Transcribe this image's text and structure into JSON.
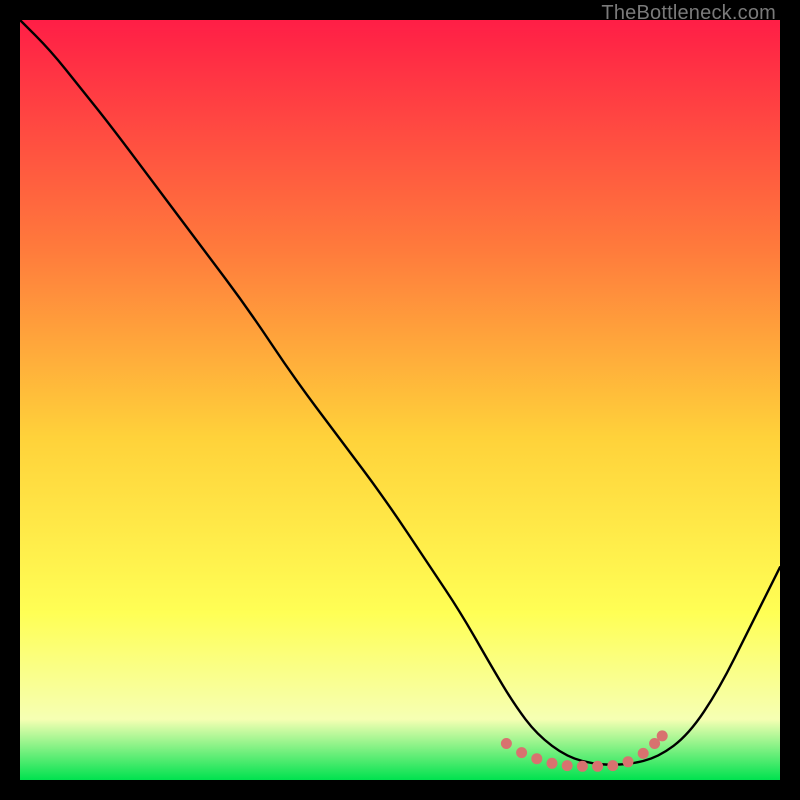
{
  "watermark": "TheBottleneck.com",
  "colors": {
    "gradient_top": "#ff1e46",
    "gradient_mid_upper": "#ff7a3c",
    "gradient_mid": "#ffd23a",
    "gradient_mid_lower": "#ffff55",
    "gradient_low": "#f6ffb3",
    "gradient_bottom": "#00e24f",
    "curve": "#000000",
    "dots": "#d8726f",
    "frame": "#000000"
  },
  "chart_data": {
    "type": "line",
    "title": "",
    "xlabel": "",
    "ylabel": "",
    "xlim": [
      0,
      100
    ],
    "ylim": [
      0,
      100
    ],
    "series": [
      {
        "name": "bottleneck-curve",
        "x": [
          0,
          4,
          8,
          12,
          18,
          24,
          30,
          36,
          42,
          48,
          54,
          58,
          62,
          65,
          68,
          72,
          76,
          80,
          84,
          88,
          92,
          96,
          100
        ],
        "y": [
          100,
          96,
          91,
          86,
          78,
          70,
          62,
          53,
          45,
          37,
          28,
          22,
          15,
          10,
          6,
          3,
          2,
          2,
          3,
          6,
          12,
          20,
          28
        ]
      }
    ],
    "dots": {
      "name": "optimal-band",
      "x": [
        64,
        66,
        68,
        70,
        72,
        74,
        76,
        78,
        80,
        82,
        83.5,
        84.5
      ],
      "y": [
        4.8,
        3.6,
        2.8,
        2.2,
        1.9,
        1.8,
        1.8,
        1.9,
        2.4,
        3.5,
        4.8,
        5.8
      ]
    }
  }
}
